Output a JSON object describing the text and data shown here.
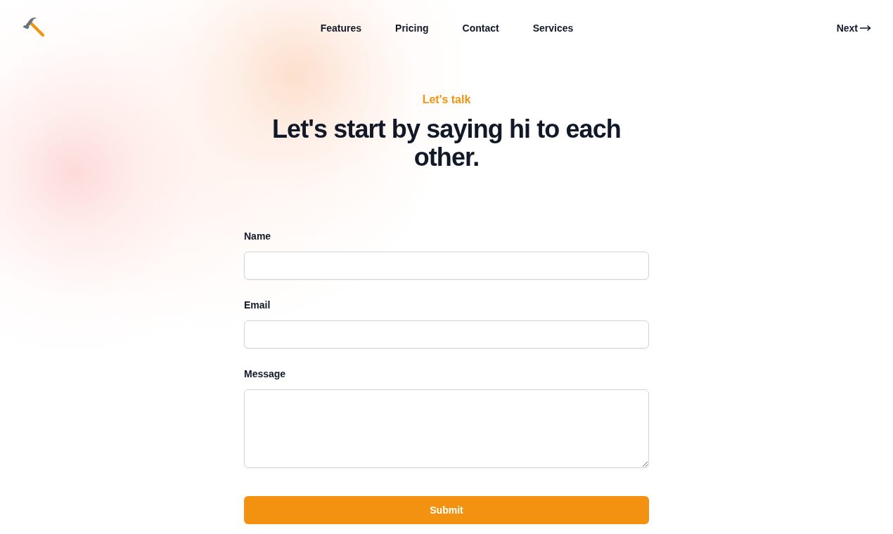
{
  "header": {
    "nav": [
      {
        "label": "Features"
      },
      {
        "label": "Pricing"
      },
      {
        "label": "Contact"
      },
      {
        "label": "Services"
      }
    ],
    "next": {
      "label": "Next"
    }
  },
  "hero": {
    "eyebrow": "Let's talk",
    "title": "Let's start by saying hi to each other."
  },
  "form": {
    "fields": [
      {
        "label": "Name",
        "kind": "input"
      },
      {
        "label": "Email",
        "kind": "input"
      },
      {
        "label": "Message",
        "kind": "textarea"
      }
    ],
    "submit": {
      "label": "Submit"
    }
  }
}
